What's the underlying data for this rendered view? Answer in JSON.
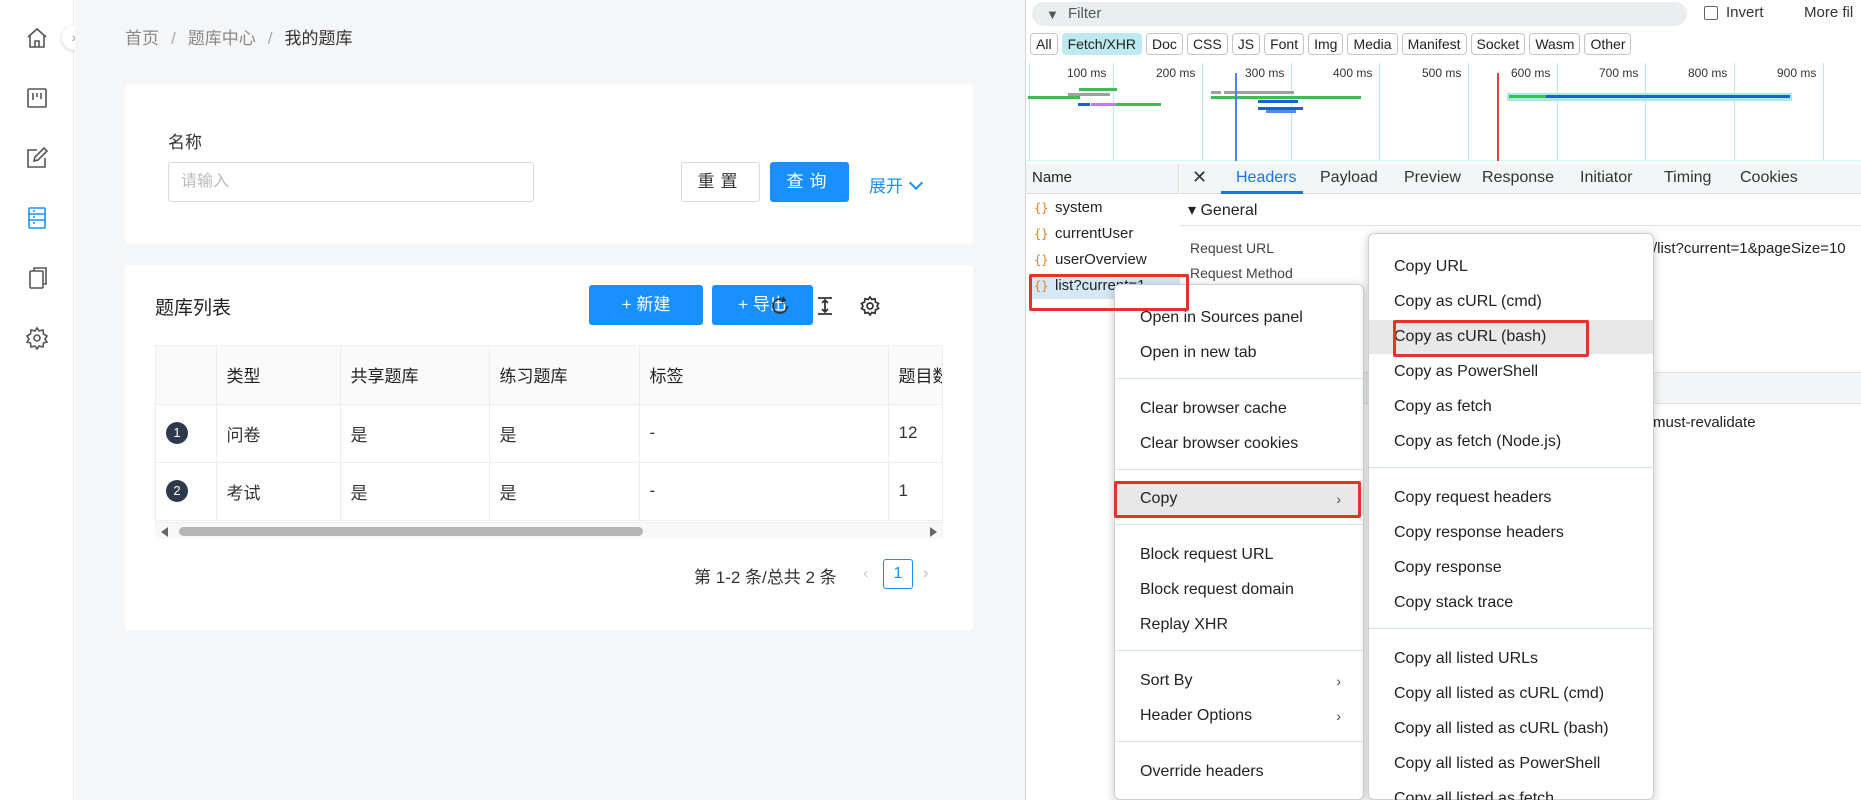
{
  "sidebar": {
    "icons": [
      "home-icon",
      "board-icon",
      "edit-icon",
      "question-bank-icon",
      "copy-icon",
      "settings-icon"
    ],
    "collapse": "›"
  },
  "breadcrumb": {
    "home": "首页",
    "center": "题库中心",
    "current": "我的题库",
    "sep": "/"
  },
  "search": {
    "name_label": "名称",
    "name_placeholder": "请输入",
    "reset": "重置",
    "query": "查询",
    "expand": "展开"
  },
  "table": {
    "title": "题库列表",
    "new_label": "+ 新建",
    "export_label": "+ 导出",
    "columns": [
      "",
      "类型",
      "共享题库",
      "练习题库",
      "标签",
      "题目数"
    ],
    "rows": [
      {
        "idx": "1",
        "type": "问卷",
        "shared": "是",
        "practice": "是",
        "tags": "-",
        "count": "12"
      },
      {
        "idx": "2",
        "type": "考试",
        "shared": "是",
        "practice": "是",
        "tags": "-",
        "count": "1"
      }
    ],
    "pager_text": "第 1-2 条/总共 2 条",
    "page": "1",
    "prev": "‹",
    "next": "›"
  },
  "devtools": {
    "filter_placeholder": "Filter",
    "invert": "Invert",
    "more_filters": "More fil",
    "chips": [
      "All",
      "Fetch/XHR",
      "Doc",
      "CSS",
      "JS",
      "Font",
      "Img",
      "Media",
      "Manifest",
      "Socket",
      "Wasm",
      "Other"
    ],
    "active_chip": "Fetch/XHR",
    "ticks": [
      "100 ms",
      "200 ms",
      "300 ms",
      "400 ms",
      "500 ms",
      "600 ms",
      "700 ms",
      "800 ms",
      "900 ms"
    ],
    "name_header": "Name",
    "requests": [
      "system",
      "currentUser",
      "userOverview",
      "list?current=1"
    ],
    "tabs": [
      "Headers",
      "Payload",
      "Preview",
      "Response",
      "Initiator",
      "Timing",
      "Cookies"
    ],
    "active_tab": "Headers",
    "general": "▾ General",
    "request_url_label": "Request URL",
    "request_url_value": "/list?current=1&pageSize=10",
    "request_method_label": "Request Method",
    "cache_value": "must-revalidate"
  },
  "context_menu": {
    "items": [
      "Open in Sources panel",
      "Open in new tab",
      "Clear browser cache",
      "Clear browser cookies",
      "Copy",
      "Block request URL",
      "Block request domain",
      "Replay XHR",
      "Sort By",
      "Header Options",
      "Override headers"
    ]
  },
  "copy_menu": {
    "items": [
      "Copy URL",
      "Copy as cURL (cmd)",
      "Copy as cURL (bash)",
      "Copy as PowerShell",
      "Copy as fetch",
      "Copy as fetch (Node.js)",
      "Copy request headers",
      "Copy response headers",
      "Copy response",
      "Copy stack trace",
      "Copy all listed URLs",
      "Copy all listed as cURL (cmd)",
      "Copy all listed as cURL (bash)",
      "Copy all listed as PowerShell",
      "Copy all listed as fetch"
    ],
    "submenu_arrow": "›"
  },
  "colors": {
    "primary": "#1890ff",
    "highlight": "#e5332a",
    "devtools_accent": "#1a73e8"
  }
}
